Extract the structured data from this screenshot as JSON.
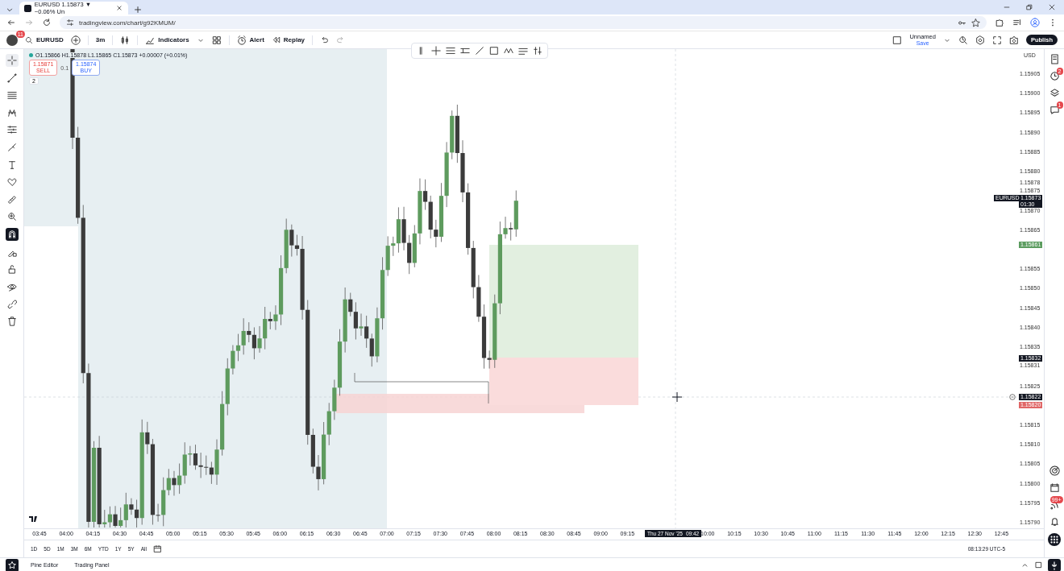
{
  "browser": {
    "tabs": [
      {
        "title": "EURUSD 1.15873 ▼ −0.06% Un",
        "selected": true
      }
    ],
    "url": "tradingview.com/chart/g92KMUM/"
  },
  "toolbar": {
    "notifications": "11",
    "symbol": "EURUSD",
    "interval": "3m",
    "indicators": "Indicators",
    "alert": "Alert",
    "replay": "Replay",
    "layout_name": "Unnamed",
    "layout_status": "Save",
    "publish": "Publish"
  },
  "legend": {
    "ohlc": "O1.15866 H1.15878 L1.15865 C1.15873 +0.00007 (+0.01%)",
    "sell_price": "1.15871",
    "sell_label": "SELL",
    "spread": "0.1",
    "buy_price": "1.15874",
    "buy_label": "BUY",
    "indicator_count": "2"
  },
  "left_toolbar": [
    {
      "kind": "crosshair",
      "selected": true
    },
    {
      "kind": "trendline",
      "selected": false
    },
    {
      "kind": "fib",
      "selected": false
    },
    {
      "kind": "pattern",
      "selected": false
    },
    {
      "kind": "forecast",
      "selected": false
    },
    {
      "kind": "brush",
      "selected": false
    },
    {
      "kind": "text",
      "selected": false
    },
    {
      "kind": "heart",
      "selected": false
    },
    {
      "kind": "ruler",
      "selected": false
    },
    {
      "kind": "zoom",
      "selected": false
    },
    {
      "kind": "magnet",
      "selected": true
    },
    {
      "kind": "lockdraw",
      "selected": false
    },
    {
      "kind": "lock",
      "selected": false
    },
    {
      "kind": "eye",
      "selected": false
    },
    {
      "kind": "link",
      "selected": false
    },
    {
      "kind": "trash",
      "selected": false
    }
  ],
  "price_axis": {
    "currency": "USD",
    "labels": [
      "1.15905",
      "1.15900",
      "1.15895",
      "1.15890",
      "1.15885",
      "1.15880",
      "1.15875",
      "1.15870",
      "1.15865",
      "1.15855",
      "1.15850",
      "1.15845",
      "1.15840",
      "1.15835",
      "1.15825",
      "1.15815",
      "1.15810",
      "1.15805",
      "1.15800",
      "1.15795",
      "1.15790"
    ],
    "extremes": [
      "1.15878",
      "1.15831"
    ],
    "tags": [
      {
        "kind": "last",
        "symbol": "EURUSD",
        "price": "1.15873",
        "countdown": "01:30",
        "color": "#131722"
      },
      {
        "kind": "level",
        "price": "1.15861",
        "color": "#5b9c5f"
      },
      {
        "kind": "level",
        "price": "1.15832",
        "color": "#131722"
      },
      {
        "kind": "crosshair",
        "price": "1.15822",
        "color": "#131722"
      },
      {
        "kind": "level",
        "price": "1.15820",
        "color": "#e06666"
      }
    ]
  },
  "time_axis": {
    "labels": [
      "03:45",
      "04:00",
      "04:15",
      "04:30",
      "04:45",
      "05:00",
      "05:15",
      "05:30",
      "05:45",
      "06:00",
      "06:15",
      "06:30",
      "06:45",
      "07:00",
      "07:15",
      "07:30",
      "07:45",
      "08:00",
      "08:15",
      "08:30",
      "08:45",
      "09:00",
      "09:15",
      "10:00",
      "10:15",
      "10:30",
      "10:45",
      "11:00",
      "11:15",
      "11:30",
      "11:45",
      "12:00",
      "12:15",
      "12:30",
      "12:45"
    ],
    "crosshair_date": "Thu 27 Nov '25",
    "crosshair_time": "09:42"
  },
  "ranges": [
    {
      "label": "1D"
    },
    {
      "label": "5D"
    },
    {
      "label": "1M"
    },
    {
      "label": "3M"
    },
    {
      "label": "6M"
    },
    {
      "label": "YTD"
    },
    {
      "label": "1Y"
    },
    {
      "label": "5Y"
    },
    {
      "label": "All"
    }
  ],
  "clock": "08:13:29 UTC-5",
  "right_sidebar": {
    "alerts_badge": "2",
    "chat_badge": "1",
    "news_badge": "99+"
  },
  "bottom_tabs": [
    {
      "label": "Pine Editor"
    },
    {
      "label": "Trading Panel"
    }
  ]
}
